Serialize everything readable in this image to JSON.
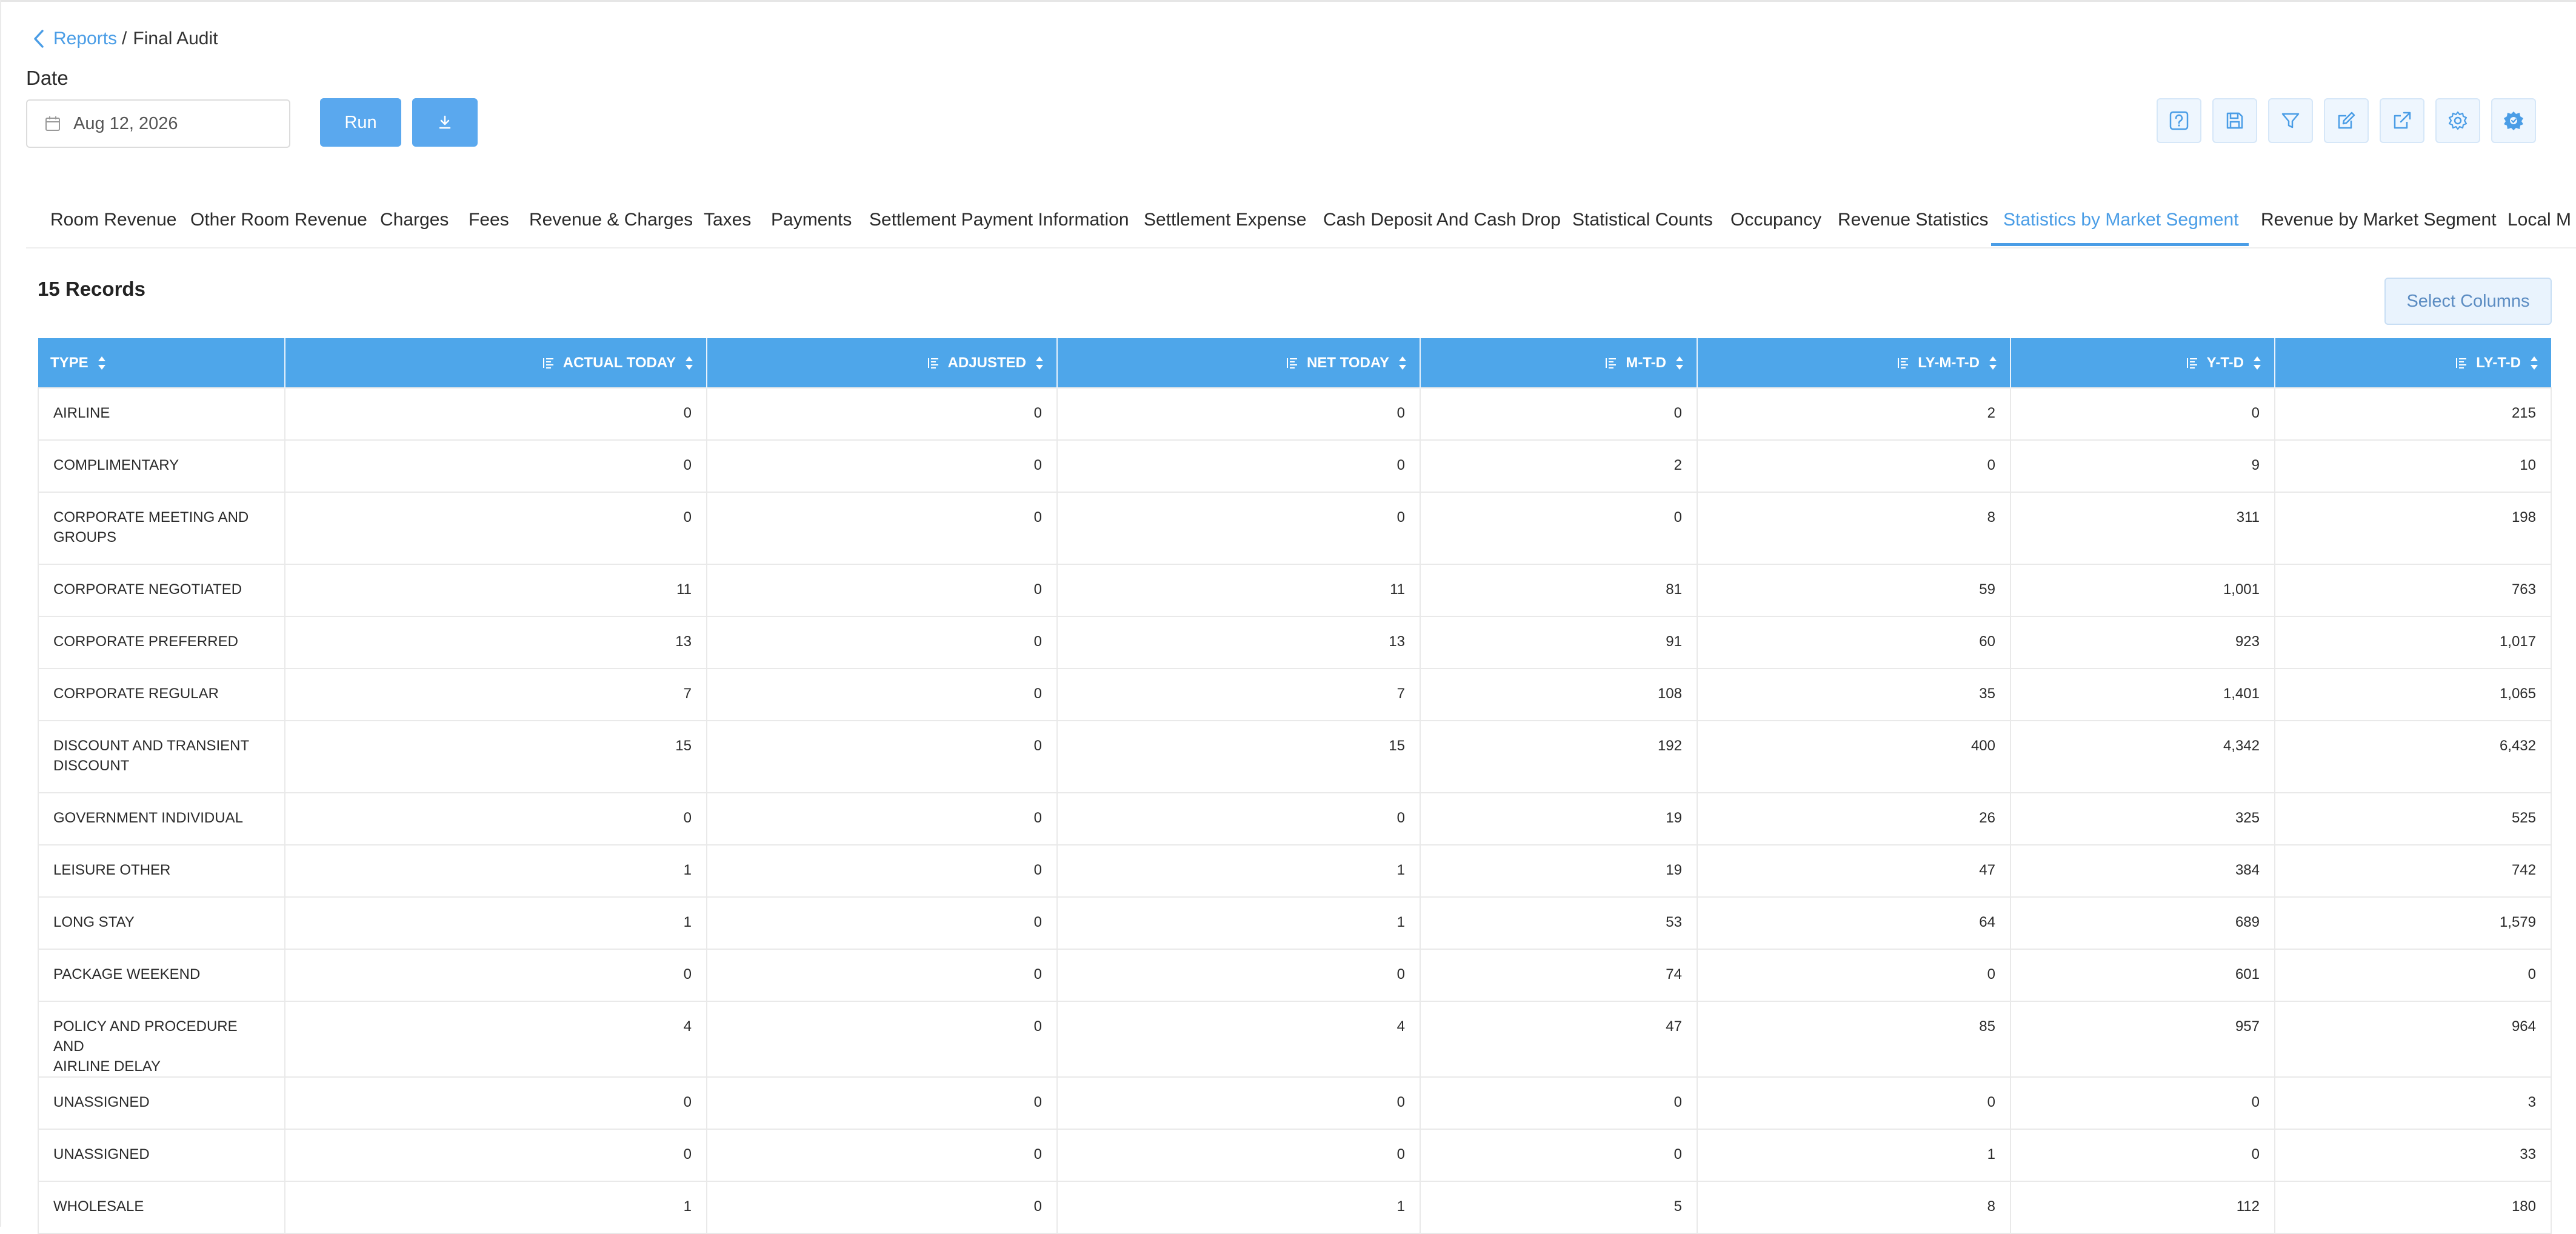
{
  "breadcrumb": {
    "parent": "Reports",
    "separator": "/",
    "current": "Final Audit"
  },
  "date": {
    "label": "Date",
    "value": "Aug 12, 2026"
  },
  "buttons": {
    "run": "Run",
    "download_icon": "download-icon"
  },
  "toolbar_icons": [
    "help-icon",
    "save-icon",
    "filter-icon",
    "edit-icon",
    "external-link-icon",
    "settings-icon",
    "advanced-settings-icon"
  ],
  "tabs": [
    "Room Revenue",
    "Other Room Revenue",
    "Charges",
    "Fees",
    "Revenue & Charges",
    "Taxes",
    "Payments",
    "Settlement Payment Information",
    "Settlement Expense",
    "Cash Deposit And Cash Drop",
    "Statistical Counts",
    "Occupancy",
    "Revenue Statistics",
    "Statistics by Market Segment",
    "Revenue by Market Segment",
    "Local M"
  ],
  "active_tab": "Statistics by Market Segment",
  "records_label": "15 Records",
  "select_columns_label": "Select Columns",
  "colors": {
    "accent": "#4a9de6",
    "header_bg": "#4ea6ea",
    "button": "#5aa8ee"
  },
  "table": {
    "columns": [
      "TYPE",
      "ACTUAL TODAY",
      "ADJUSTED",
      "NET TODAY",
      "M-T-D",
      "LY-M-T-D",
      "Y-T-D",
      "LY-T-D"
    ],
    "rows": [
      {
        "type": "AIRLINE",
        "values": [
          "0",
          "0",
          "0",
          "0",
          "2",
          "0",
          "215"
        ]
      },
      {
        "type": "COMPLIMENTARY",
        "values": [
          "0",
          "0",
          "0",
          "2",
          "0",
          "9",
          "10"
        ]
      },
      {
        "type": "CORPORATE MEETING AND\nGROUPS",
        "values": [
          "0",
          "0",
          "0",
          "0",
          "8",
          "311",
          "198"
        ]
      },
      {
        "type": "CORPORATE NEGOTIATED",
        "values": [
          "11",
          "0",
          "11",
          "81",
          "59",
          "1,001",
          "763"
        ]
      },
      {
        "type": "CORPORATE PREFERRED",
        "values": [
          "13",
          "0",
          "13",
          "91",
          "60",
          "923",
          "1,017"
        ]
      },
      {
        "type": "CORPORATE REGULAR",
        "values": [
          "7",
          "0",
          "7",
          "108",
          "35",
          "1,401",
          "1,065"
        ]
      },
      {
        "type": "DISCOUNT AND TRANSIENT\nDISCOUNT",
        "values": [
          "15",
          "0",
          "15",
          "192",
          "400",
          "4,342",
          "6,432"
        ]
      },
      {
        "type": "GOVERNMENT INDIVIDUAL",
        "values": [
          "0",
          "0",
          "0",
          "19",
          "26",
          "325",
          "525"
        ]
      },
      {
        "type": "LEISURE OTHER",
        "values": [
          "1",
          "0",
          "1",
          "19",
          "47",
          "384",
          "742"
        ]
      },
      {
        "type": "LONG STAY",
        "values": [
          "1",
          "0",
          "1",
          "53",
          "64",
          "689",
          "1,579"
        ]
      },
      {
        "type": "PACKAGE WEEKEND",
        "values": [
          "0",
          "0",
          "0",
          "74",
          "0",
          "601",
          "0"
        ]
      },
      {
        "type": "POLICY AND PROCEDURE AND\nAIRLINE DELAY",
        "values": [
          "4",
          "0",
          "4",
          "47",
          "85",
          "957",
          "964"
        ]
      },
      {
        "type": "UNASSIGNED",
        "values": [
          "0",
          "0",
          "0",
          "0",
          "0",
          "0",
          "3"
        ]
      },
      {
        "type": "UNASSIGNED",
        "values": [
          "0",
          "0",
          "0",
          "0",
          "1",
          "0",
          "33"
        ]
      },
      {
        "type": "WHOLESALE",
        "values": [
          "1",
          "0",
          "1",
          "5",
          "8",
          "112",
          "180"
        ]
      }
    ]
  }
}
